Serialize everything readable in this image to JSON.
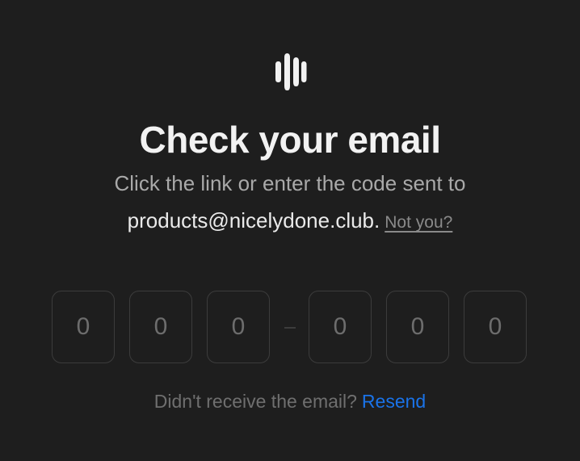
{
  "logo": {
    "icon": "bars-logo-icon"
  },
  "heading": {
    "title": "Check your email"
  },
  "subheading": {
    "line1": "Click the link or enter the code sent to",
    "email": "products@nicelydone.club.",
    "not_you": "Not you?"
  },
  "code": {
    "digits": [
      "0",
      "0",
      "0",
      "0",
      "0",
      "0"
    ],
    "separator": "–"
  },
  "footer": {
    "prompt": "Didn't receive the email?",
    "resend": "Resend"
  },
  "colors": {
    "background": "#1e1e1e",
    "title": "#f2f2f2",
    "muted": "#a9a9a9",
    "link": "#1a73e8",
    "box_border": "#3c3c3c"
  }
}
